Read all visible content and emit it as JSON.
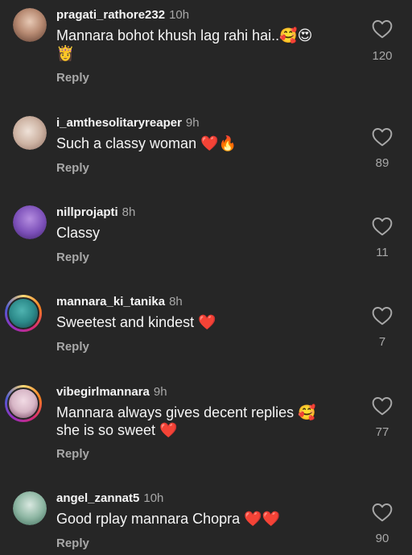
{
  "comments": [
    {
      "username": "pragati_rathore232",
      "time": "10h",
      "text_line1": "Mannara bohot khush lag rahi hai..🥰😍",
      "text_line2": "👸",
      "reply": "Reply",
      "likes": "120",
      "avatar_color": "#caa48e"
    },
    {
      "username": "i_amthesolitaryreaper",
      "time": "9h",
      "text_line1": "Such a classy woman ❤️🔥",
      "reply": "Reply",
      "likes": "89",
      "avatar_color": "#d8c3b3"
    },
    {
      "username": "nillprojapti",
      "time": "8h",
      "text_line1": "Classy",
      "reply": "Reply",
      "likes": "11",
      "avatar_color": "#7b4fb8"
    },
    {
      "username": "mannara_ki_tanika",
      "time": "8h",
      "text_line1": "Sweetest and kindest ❤️",
      "reply": "Reply",
      "likes": "7",
      "avatar_color": "#2c8a8a"
    },
    {
      "username": "vibegirlmannara",
      "time": "9h",
      "text_line1": "Mannara always gives decent replies 🥰",
      "text_line2": "she is so sweet ❤️",
      "reply": "Reply",
      "likes": "77",
      "avatar_color": "#d7b6c6"
    },
    {
      "username": "angel_zannat5",
      "time": "10h",
      "text_line1": "Good rplay mannara Chopra ❤️❤️",
      "reply": "Reply",
      "likes": "90",
      "avatar_color": "#8fb7a4"
    }
  ],
  "colors": {
    "background": "#262626",
    "primary_text": "#f5f5f5",
    "secondary_text": "#a8a8a8"
  },
  "icons": {
    "like": "heart-outline-icon"
  }
}
